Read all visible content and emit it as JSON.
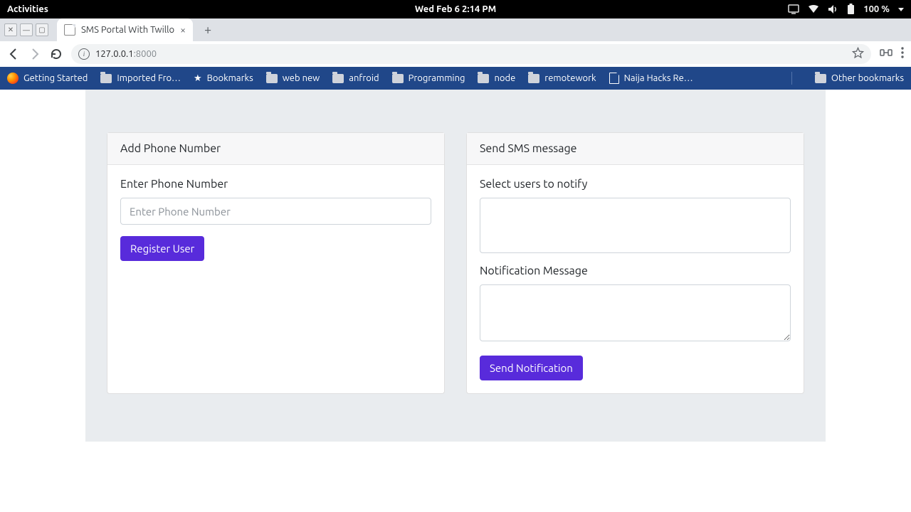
{
  "gnome": {
    "activities": "Activities",
    "clock": "Wed Feb 6  2:14 PM",
    "battery": "100 %"
  },
  "tab": {
    "title": "SMS Portal With Twillo"
  },
  "url": {
    "host": "127.0.0.1",
    "port": ":8000"
  },
  "bookmarks": {
    "getting_started": "Getting Started",
    "imported": "Imported Fro…",
    "bookmarks": "Bookmarks",
    "web_new": "web new",
    "anfroid": "anfroid",
    "programming": "Programming",
    "node": "node",
    "remotework": "remotework",
    "naija": "Naija Hacks Re…",
    "other": "Other bookmarks"
  },
  "page": {
    "left": {
      "title": "Add Phone Number",
      "phone_label": "Enter Phone Number",
      "phone_placeholder": "Enter Phone Number",
      "register_btn": "Register User"
    },
    "right": {
      "title": "Send SMS message",
      "select_label": "Select users to notify",
      "message_label": "Notification Message",
      "send_btn": "Send Notification"
    }
  }
}
